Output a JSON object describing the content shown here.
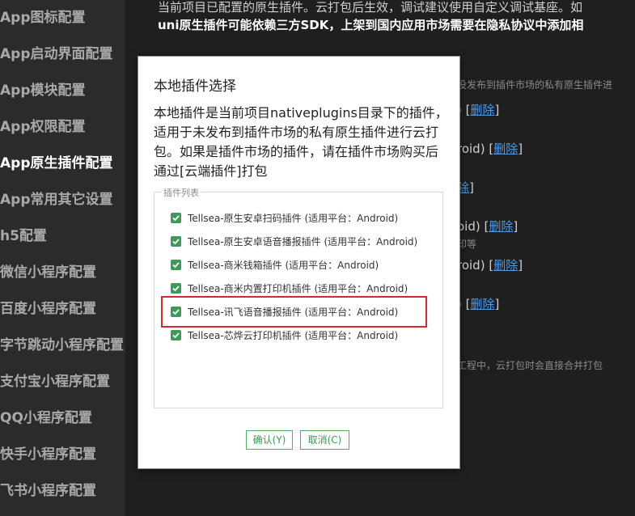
{
  "sidebar": {
    "items": [
      {
        "label": "App图标配置"
      },
      {
        "label": "App启动界面配置"
      },
      {
        "label": "App模块配置"
      },
      {
        "label": "App权限配置"
      },
      {
        "label": "App原生插件配置"
      },
      {
        "label": "App常用其它设置"
      },
      {
        "label": "h5配置"
      },
      {
        "label": "微信小程序配置"
      },
      {
        "label": "百度小程序配置"
      },
      {
        "label": "字节跳动小程序配置"
      },
      {
        "label": "支付宝小程序配置"
      },
      {
        "label": "QQ小程序配置"
      },
      {
        "label": "快手小程序配置"
      },
      {
        "label": "飞书小程序配置"
      }
    ],
    "active_index": 4
  },
  "background": {
    "line1": "当前项目已配置的原生插件。云打包后生效，调试建议使用自定义调试基座。如",
    "line2": "uni原生插件可能依赖三方SDK，上架到国内应用市场需要在隐私协议中添加相",
    "note1": "没发布到插件市场的私有原生插件进",
    "row1_prefix": ")",
    "row2_prefix": "roid)",
    "row3_prefix": "",
    "row4_prefix": "oid)",
    "row4_sub": "印等",
    "row5_prefix": "roid)",
    "row6_prefix": ")",
    "delete_link": "删除",
    "note2": "工程中，云打包时会直接合并打包"
  },
  "dialog": {
    "title": "本地插件选择",
    "description": "本地插件是当前项目nativeplugins目录下的插件，适用于未发布到插件市场的私有原生插件进行云打包。如果是插件市场的插件，请在插件市场购买后通过[云端插件]打包",
    "group_legend": "插件列表",
    "plugins": [
      {
        "label": "Tellsea-原生安卓扫码插件 (适用平台：Android)",
        "checked": true
      },
      {
        "label": "Tellsea-原生安卓语音播报插件 (适用平台：Android)",
        "checked": true
      },
      {
        "label": "Tellsea-商米钱箱插件 (适用平台：Android)",
        "checked": true
      },
      {
        "label": "Tellsea-商米内置打印机插件 (适用平台：Android)",
        "checked": true
      },
      {
        "label": "Tellsea-讯飞语音播报插件 (适用平台：Android)",
        "checked": true
      },
      {
        "label": "Tellsea-芯烨云打印机插件 (适用平台：Android)",
        "checked": true
      }
    ],
    "ok_label": "确认(Y)",
    "cancel_label": "取消(C)"
  },
  "colors": {
    "checkbox": "#3e9a58",
    "highlight": "#d9282c",
    "button_border": "#4caf6a",
    "link": "#4c9be8"
  }
}
